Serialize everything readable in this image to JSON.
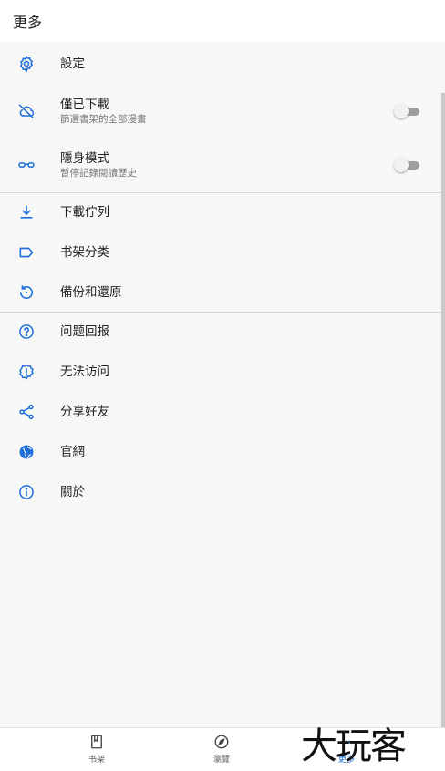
{
  "appbar": {
    "title": "更多"
  },
  "colors": {
    "accent": "#1e6fd9"
  },
  "menu": {
    "settings": {
      "title": "設定",
      "icon": "gear-icon"
    },
    "downloaded_only": {
      "title": "僅已下載",
      "subtitle": "篩選書架的全部漫畫",
      "icon": "cloud-off-icon",
      "enabled": false
    },
    "incognito": {
      "title": "隱身模式",
      "subtitle": "暫停記錄閱讀歷史",
      "icon": "glasses-icon",
      "enabled": false
    },
    "download_queue": {
      "title": "下載佇列",
      "icon": "download-icon"
    },
    "categories": {
      "title": "书架分类",
      "icon": "label-icon"
    },
    "backup": {
      "title": "備份和還原",
      "icon": "restore-icon"
    },
    "report": {
      "title": "问题回报",
      "icon": "help-circle-icon"
    },
    "unreachable": {
      "title": "无法访问",
      "icon": "alert-badge-icon"
    },
    "share": {
      "title": "分享好友",
      "icon": "share-icon"
    },
    "website": {
      "title": "官網",
      "icon": "globe-icon"
    },
    "about": {
      "title": "關於",
      "icon": "info-icon"
    }
  },
  "bottom_nav": {
    "library": {
      "label": "书架",
      "icon": "book-icon"
    },
    "browse": {
      "label": "瀏覽",
      "icon": "compass-icon"
    },
    "more": {
      "label": "更多",
      "icon": "more-dots-icon",
      "active": true
    }
  },
  "watermark": "大玩客"
}
